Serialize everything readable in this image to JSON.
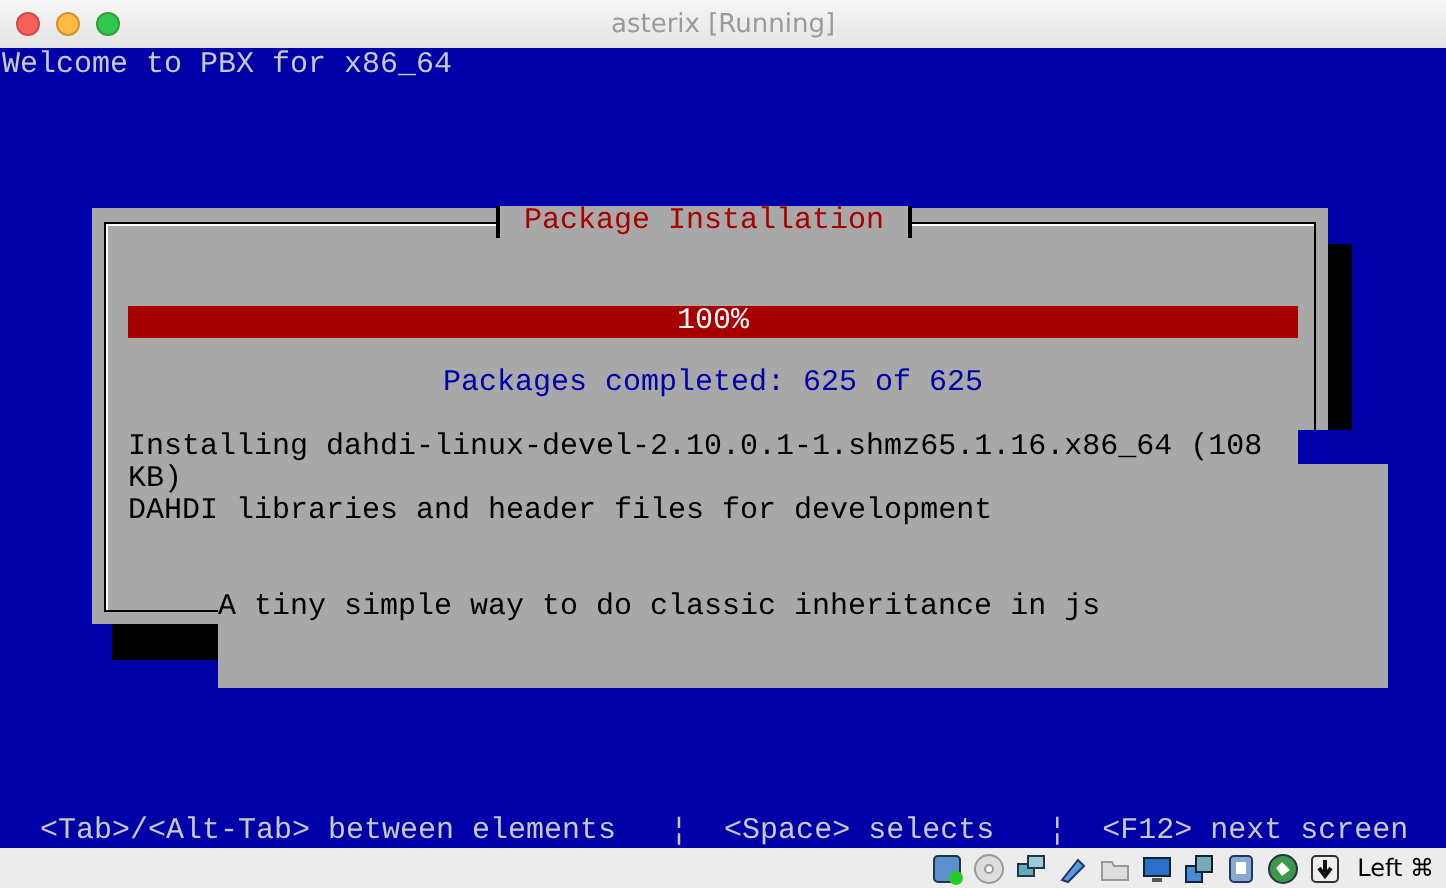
{
  "window": {
    "title": "asterix [Running]"
  },
  "console": {
    "header": "Welcome to PBX for x86_64",
    "dialog": {
      "title": "Package Installation",
      "progress": {
        "level": 1,
        "label": "100%"
      },
      "summary": "Packages completed: 625 of 625",
      "lines": [
        "Installing dahdi-linux-devel-2.10.0.1-1.shmz65.1.16.x86_64 (108",
        "KB)",
        "DAHDI libraries and header files for development"
      ]
    },
    "overlay_text": "A tiny simple way to do classic inheritance in js",
    "help_line": "<Tab>/<Alt-Tab> between elements   ¦  <Space> selects   ¦  <F12> next screen"
  },
  "status_bar": {
    "host_key": "Left ⌘"
  }
}
